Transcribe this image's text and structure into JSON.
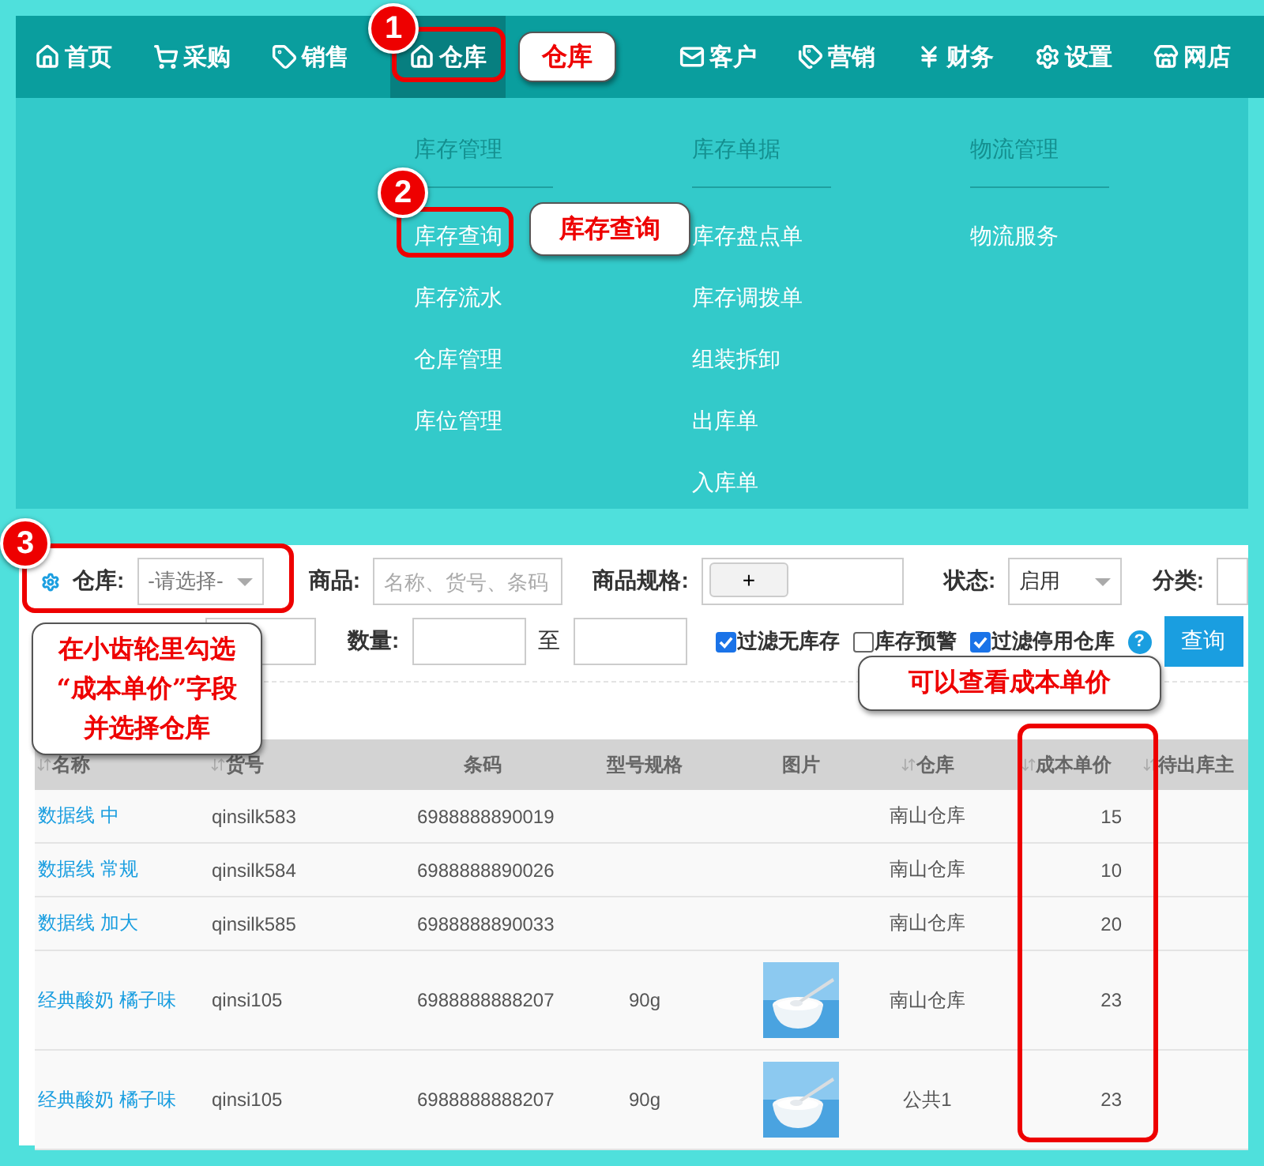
{
  "nav": {
    "items": [
      {
        "label": "首页",
        "selected": false
      },
      {
        "label": "采购",
        "selected": false
      },
      {
        "label": "销售",
        "selected": false
      },
      {
        "label": "仓库",
        "selected": true
      },
      {
        "label": "客户",
        "selected": false
      },
      {
        "label": "营销",
        "selected": false
      },
      {
        "label": "财务",
        "selected": false
      },
      {
        "label": "设置",
        "selected": false
      },
      {
        "label": "网店",
        "selected": false
      }
    ]
  },
  "menu": {
    "columns": [
      {
        "title": "库存管理",
        "items": [
          "库存查询",
          "库存流水",
          "仓库管理",
          "库位管理"
        ]
      },
      {
        "title": "库存单据",
        "items": [
          "库存盘点单",
          "库存调拨单",
          "组装拆卸",
          "出库单",
          "入库单"
        ]
      },
      {
        "title": "物流管理",
        "items": [
          "物流服务"
        ]
      }
    ]
  },
  "filters": {
    "warehouse_label": "仓库:",
    "warehouse_select": "-请选择-",
    "product_label": "商品:",
    "product_placeholder": "名称、货号、条码",
    "spec_label": "商品规格:",
    "spec_button": "+",
    "status_label": "状态:",
    "status_select": "启用",
    "category_label": "分类:",
    "quantity_label": "数量:",
    "range_sep": "至",
    "checks": [
      {
        "label": "过滤无库存",
        "checked": true
      },
      {
        "label": "库存预警",
        "checked": false
      },
      {
        "label": "过滤停用仓库",
        "checked": true
      }
    ],
    "help": "?",
    "query_button": "查询"
  },
  "table": {
    "columns": [
      {
        "label": "名称",
        "sortable": true
      },
      {
        "label": "货号",
        "sortable": true
      },
      {
        "label": "条码",
        "sortable": false
      },
      {
        "label": "型号规格",
        "sortable": false
      },
      {
        "label": "图片",
        "sortable": false
      },
      {
        "label": "仓库",
        "sortable": true
      },
      {
        "label": "成本单价",
        "sortable": true
      },
      {
        "label": "待出库主",
        "sortable": true
      }
    ],
    "rows": [
      {
        "name": "数据线 中",
        "code": "qinsilk583",
        "barcode": "6988888890019",
        "spec": "",
        "picture": false,
        "warehouse": "南山仓库",
        "cost": "15"
      },
      {
        "name": "数据线 常规",
        "code": "qinsilk584",
        "barcode": "6988888890026",
        "spec": "",
        "picture": false,
        "warehouse": "南山仓库",
        "cost": "10"
      },
      {
        "name": "数据线 加大",
        "code": "qinsilk585",
        "barcode": "6988888890033",
        "spec": "",
        "picture": false,
        "warehouse": "南山仓库",
        "cost": "20"
      },
      {
        "name": "经典酸奶 橘子味",
        "code": "qinsi105",
        "barcode": "6988888888207",
        "spec": "90g",
        "picture": true,
        "warehouse": "南山仓库",
        "cost": "23"
      },
      {
        "name": "经典酸奶 橘子味",
        "code": "qinsi105",
        "barcode": "6988888888207",
        "spec": "90g",
        "picture": true,
        "warehouse": "公共1",
        "cost": "23"
      }
    ]
  },
  "annotations": {
    "markers": [
      "1",
      "2",
      "3"
    ],
    "callouts": [
      {
        "lines": [
          "仓库"
        ]
      },
      {
        "lines": [
          "库存查询"
        ]
      },
      {
        "lines": [
          "在小齿轮里勾选",
          "“成本单价”字段",
          "并选择仓库"
        ]
      },
      {
        "lines": [
          "可以查看成本单价"
        ]
      }
    ]
  }
}
